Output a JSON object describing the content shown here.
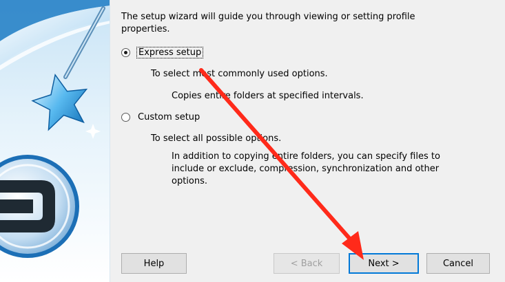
{
  "intro_text": "The setup wizard will guide you through viewing or setting  profile properties.",
  "options": {
    "express": {
      "label": "Express setup",
      "checked": true,
      "summary": "To select most commonly used options.",
      "detail": "Copies entire folders at specified intervals."
    },
    "custom": {
      "label": "Custom setup",
      "checked": false,
      "summary": "To select all possible options.",
      "detail": "In addition to copying entire folders, you can specify files to include or exclude, compression, synchronization and other options."
    }
  },
  "buttons": {
    "help": "Help",
    "back": "< Back",
    "next": "Next >",
    "cancel": "Cancel"
  },
  "icons": {
    "banner": "magic-wand-star-icon",
    "logo": "product-logo-icon",
    "annotation": "red-arrow-annotation"
  },
  "colors": {
    "annotation_arrow": "#ff2a1a",
    "default_button_border": "#0078d7",
    "banner_blue": "#2f8fd0"
  }
}
